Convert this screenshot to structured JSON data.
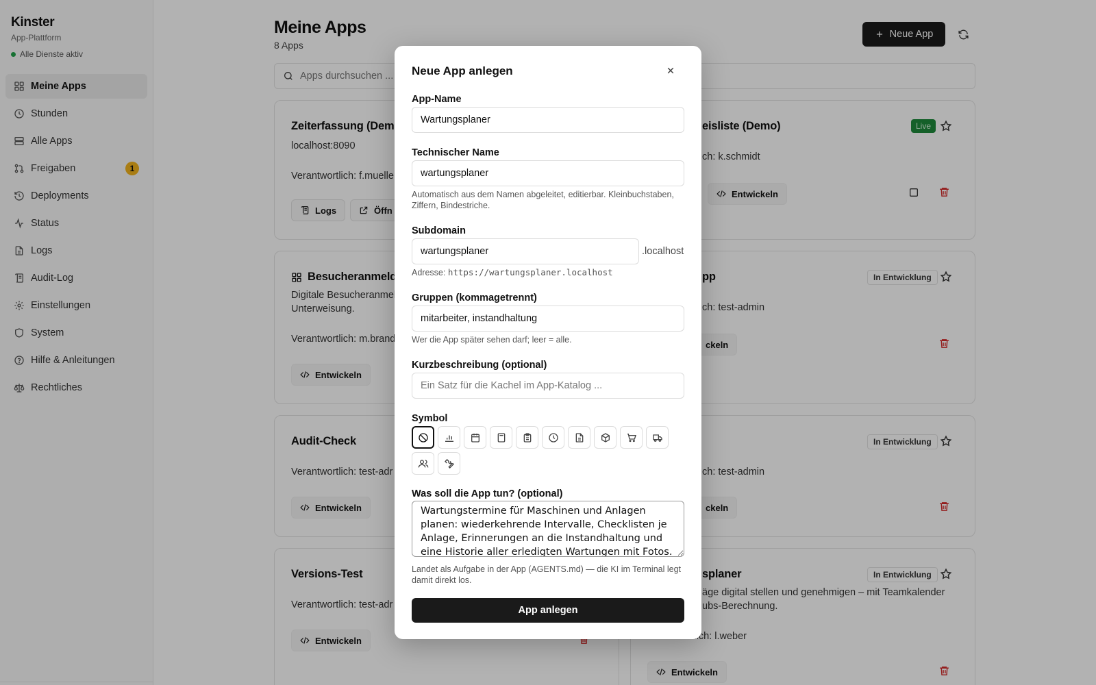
{
  "sidebar": {
    "brand": "Kinster",
    "subtitle": "App-Plattform",
    "status": "Alle Dienste aktiv",
    "items": [
      {
        "label": "Meine Apps",
        "icon": "grid-icon",
        "active": true
      },
      {
        "label": "Stunden",
        "icon": "clock-icon"
      },
      {
        "label": "Alle Apps",
        "icon": "server-icon"
      },
      {
        "label": "Freigaben",
        "icon": "git-pull-request-icon",
        "badge": "1"
      },
      {
        "label": "Deployments",
        "icon": "history-icon"
      },
      {
        "label": "Status",
        "icon": "activity-icon"
      },
      {
        "label": "Logs",
        "icon": "file-text-icon"
      },
      {
        "label": "Audit-Log",
        "icon": "scroll-icon"
      },
      {
        "label": "Einstellungen",
        "icon": "gear-icon"
      },
      {
        "label": "System",
        "icon": "shield-icon"
      },
      {
        "label": "Hilfe & Anleitungen",
        "icon": "help-circle-icon"
      },
      {
        "label": "Rechtliches",
        "icon": "scale-icon"
      }
    ]
  },
  "header": {
    "title": "Meine Apps",
    "count": "8 Apps",
    "new_button": "Neue App",
    "search_placeholder": "Apps durchsuchen ..."
  },
  "cards": {
    "c1": {
      "title": "Zeiterfassung (Demo",
      "host": "localhost:8090",
      "owner": "Verantwortlich: f.muelle",
      "btn_logs": "Logs",
      "btn_open": "Öffn"
    },
    "c2": {
      "title": "eisliste (Demo)",
      "owner": "ch: k.schmidt",
      "badge": "Live",
      "btn_dev": "Entwickeln"
    },
    "c3": {
      "title": "Besucheranmeldu",
      "desc1": "Digitale Besucheranmel",
      "desc2": "Unterweisung.",
      "owner": "Verantwortlich: m.brand",
      "btn_dev": "Entwickeln"
    },
    "c4": {
      "title": "pp",
      "owner": "ch: test-admin",
      "badge": "In Entwicklung",
      "btn_dev": "ckeln"
    },
    "c5": {
      "title": "Audit-Check",
      "owner": "Verantwortlich: test-adr",
      "btn_dev": "Entwickeln"
    },
    "c6": {
      "owner": "ch: test-admin",
      "badge": "In Entwicklung",
      "btn_dev": "ckeln"
    },
    "c7": {
      "title": "Versions-Test",
      "owner": "Verantwortlich: test-adr",
      "btn_dev": "Entwickeln"
    },
    "c8": {
      "title": "splaner",
      "desc1": "äge digital stellen und genehmigen – mit Teamkalender",
      "desc2": "ubs-Berechnung.",
      "owner": "erantwortlich: l.weber",
      "badge": "In Entwicklung",
      "btn_dev": "Entwickeln"
    }
  },
  "modal": {
    "title": "Neue App anlegen",
    "app_name_label": "App-Name",
    "app_name_value": "Wartungsplaner",
    "tech_name_label": "Technischer Name",
    "tech_name_value": "wartungsplaner",
    "tech_name_help": "Automatisch aus dem Namen abgeleitet, editierbar. Kleinbuchstaben, Ziffern, Bindestriche.",
    "subdomain_label": "Subdomain",
    "subdomain_value": "wartungsplaner",
    "subdomain_suffix": ".localhost",
    "address_prefix": "Adresse:",
    "address_value": "https://wartungsplaner.localhost",
    "groups_label": "Gruppen (kommagetrennt)",
    "groups_value": "mitarbeiter, instandhaltung",
    "groups_help": "Wer die App später sehen darf; leer = alle.",
    "short_desc_label": "Kurzbeschreibung (optional)",
    "short_desc_placeholder": "Ein Satz für die Kachel im App-Katalog ...",
    "symbol_label": "Symbol",
    "symbols": [
      "none-icon",
      "bar-chart-icon",
      "calendar-icon",
      "calculator-icon",
      "clipboard-icon",
      "clock-icon",
      "file-text-icon",
      "package-icon",
      "cart-icon",
      "truck-icon",
      "users-icon",
      "wrench-icon"
    ],
    "purpose_label": "Was soll die App tun? (optional)",
    "purpose_value": "Wartungstermine für Maschinen und Anlagen planen: wiederkehrende Intervalle, Checklisten je Anlage, Erinnerungen an die Instandhaltung und eine Historie aller erledigten Wartungen mit Fotos.",
    "purpose_help": "Landet als Aufgabe in der App (AGENTS.md) — die KI im Terminal legt damit direkt los.",
    "submit": "App anlegen"
  }
}
